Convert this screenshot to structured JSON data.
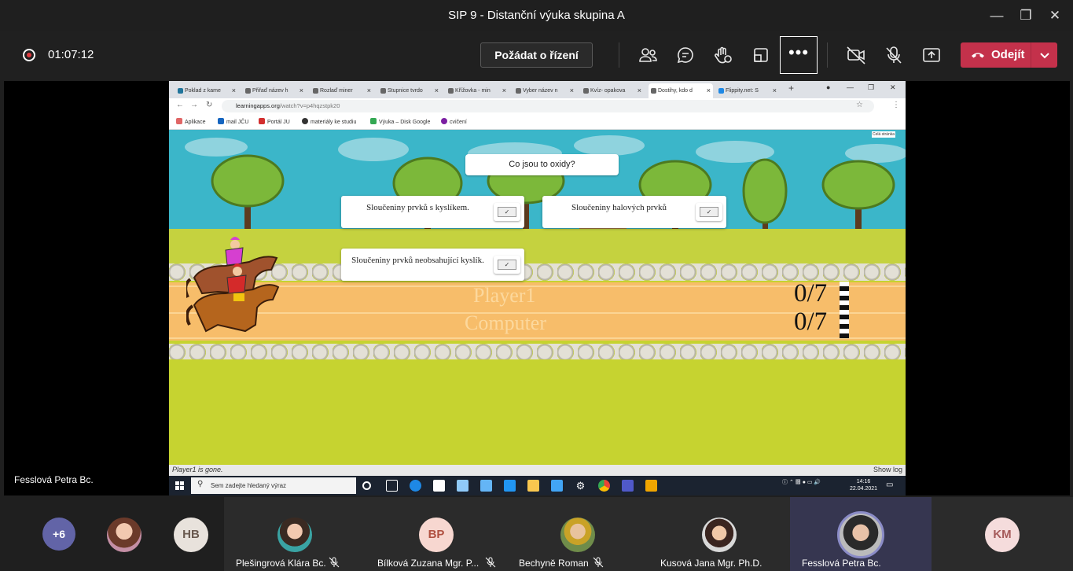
{
  "window": {
    "title": "SIP 9 - Distanční výuka skupina A"
  },
  "toolbar": {
    "timer": "01:07:12",
    "request_control": "Požádat o řízení",
    "leave": "Odejít",
    "more": "•••"
  },
  "presenter_name": "Fesslová Petra Bc.",
  "browser": {
    "tabs": [
      {
        "label": "Poklad z kame"
      },
      {
        "label": "Přiřaď název h"
      },
      {
        "label": "Rozlaď miner"
      },
      {
        "label": "Stupnice tvrdo"
      },
      {
        "label": "Křížovka - min"
      },
      {
        "label": "Vyber název n"
      },
      {
        "label": "Kvíz- opakova"
      },
      {
        "label": "Dostihy, kdo d"
      },
      {
        "label": "Flippity.net: S"
      }
    ],
    "url_host": "learningapps.org",
    "url_path": "/watch?v=p4hqzstpk20",
    "bookmarks": [
      "Aplikace",
      "mail JČU",
      "Portál JU",
      "materiály ke studiu",
      "Výuka – Disk Google",
      "cvičení"
    ]
  },
  "game": {
    "question": "Co jsou to oxidy?",
    "answers": [
      "Sloučeniny prvků s kyslíkem.",
      "Sloučeniny halových prvků",
      "Sloučeniny prvků neobsahující kyslík."
    ],
    "check_mark": "✓",
    "player1_label": "Player1",
    "computer_label": "Computer",
    "player1_score": "0/7",
    "computer_score": "0/7",
    "fullscreen_label": "Celá stránka",
    "status_left": "Player1 is gone.",
    "status_right": "Show log"
  },
  "taskbar": {
    "search_placeholder": "Sem zadejte hledaný výraz",
    "time": "14:16",
    "date": "22.04.2021"
  },
  "participants": {
    "overflow_count": "+6",
    "initials_hb": "HB",
    "tiles": [
      {
        "name": "Plešingrová Klára Bc.",
        "initials": ""
      },
      {
        "name": "Bílková Zuzana Mgr. P...",
        "initials": "BP"
      },
      {
        "name": "Bechyně Roman",
        "initials": ""
      },
      {
        "name": "Kusová Jana Mgr. Ph.D.",
        "initials": ""
      },
      {
        "name": "Fesslová Petra Bc.",
        "initials": ""
      },
      {
        "name": "",
        "initials": "KM"
      }
    ]
  },
  "colors": {
    "leave_red": "#c4314b",
    "sky": "#3bb6c9",
    "grass": "#c6d330",
    "track": "#f7bd6a"
  }
}
